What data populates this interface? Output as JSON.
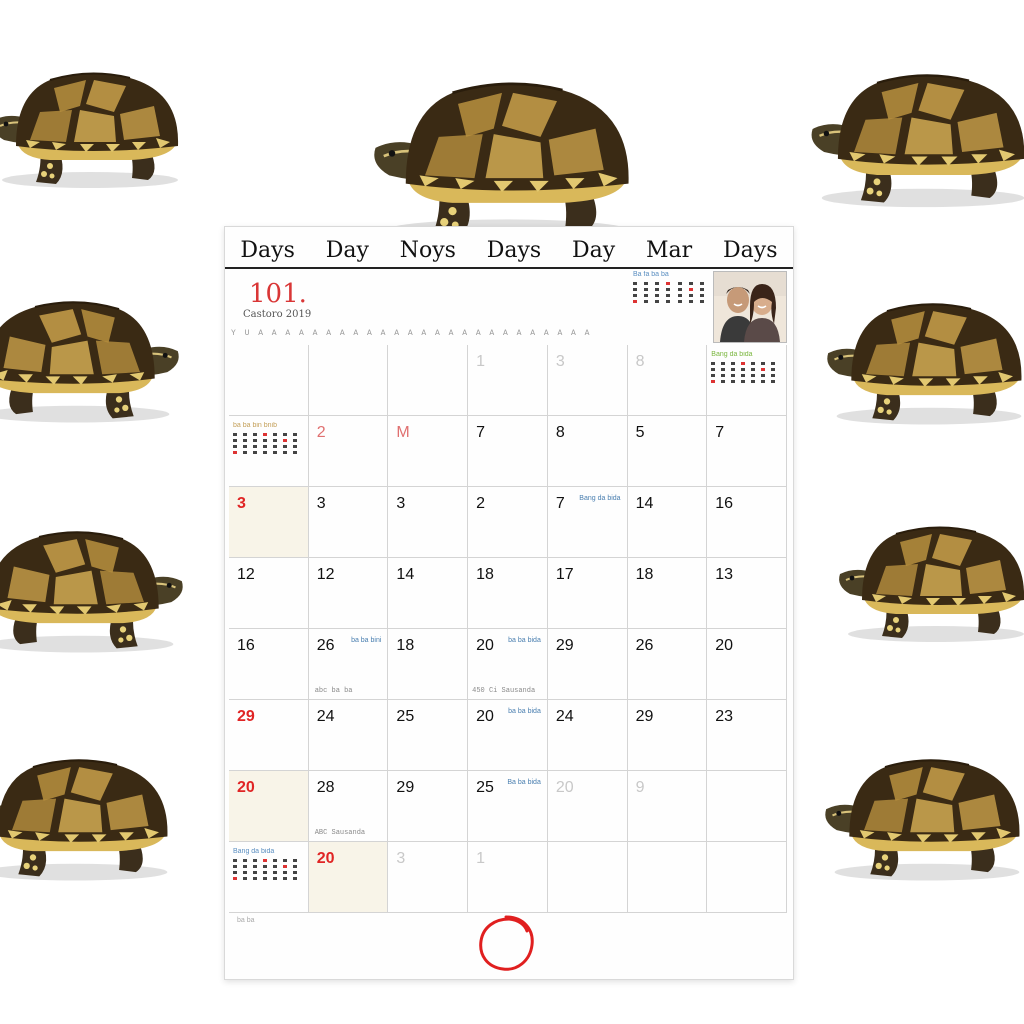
{
  "weekday_headers": [
    "Days",
    "Day",
    "Noys",
    "Days",
    "Day",
    "Mar",
    "Days"
  ],
  "header": {
    "year": "101.",
    "subtitle": "Castoro 2019",
    "tick_row": "Y U A A A A A A A A A A A A A A A A A A A A A A A A A",
    "mini_title": "Ba fa ba ba",
    "photo": "couple photo"
  },
  "rows": [
    [
      {
        "n": ""
      },
      {
        "n": ""
      },
      {
        "n": ""
      },
      {
        "n": "1",
        "s": "faint"
      },
      {
        "n": "3",
        "s": "faint"
      },
      {
        "n": "8",
        "s": "faint"
      },
      {
        "n": "",
        "mini": "green",
        "mini_title": "Bang da bida"
      }
    ],
    [
      {
        "n": "",
        "mini": "tan",
        "mini_title": "ba ba bin bnib"
      },
      {
        "n": "2",
        "s": "pink"
      },
      {
        "n": "M",
        "s": "pink"
      },
      {
        "n": "7"
      },
      {
        "n": "8"
      },
      {
        "n": "5"
      },
      {
        "n": "7"
      }
    ],
    [
      {
        "n": "3",
        "s": "red",
        "cream": true
      },
      {
        "n": "3"
      },
      {
        "n": "3"
      },
      {
        "n": "2"
      },
      {
        "n": "7",
        "note": "Bang da bida"
      },
      {
        "n": "14"
      },
      {
        "n": "16"
      }
    ],
    [
      {
        "n": "12"
      },
      {
        "n": "12"
      },
      {
        "n": "14"
      },
      {
        "n": "18"
      },
      {
        "n": "17"
      },
      {
        "n": "18"
      },
      {
        "n": "13"
      }
    ],
    [
      {
        "n": "16"
      },
      {
        "n": "26",
        "note": "ba ba bini"
      },
      {
        "n": "18"
      },
      {
        "n": "20",
        "note": "ba ba bida"
      },
      {
        "n": "29"
      },
      {
        "n": "26"
      },
      {
        "n": "20"
      }
    ],
    [
      {
        "n": "29",
        "s": "red"
      },
      {
        "n": "24"
      },
      {
        "n": "25"
      },
      {
        "n": "20",
        "note": "ba ba bida"
      },
      {
        "n": "24"
      },
      {
        "n": "29"
      },
      {
        "n": "23"
      }
    ],
    [
      {
        "n": "20",
        "s": "red",
        "cream": true
      },
      {
        "n": "28"
      },
      {
        "n": "29"
      },
      {
        "n": "25",
        "note": "Ba ba bida"
      },
      {
        "n": "20",
        "s": "faint"
      },
      {
        "n": "9",
        "s": "faint"
      },
      {
        "n": ""
      }
    ],
    [
      {
        "n": "",
        "mini": "blue",
        "mini_title": "Bang da bida"
      },
      {
        "n": "20",
        "s": "red",
        "cream": true
      },
      {
        "n": "3",
        "s": "faint"
      },
      {
        "n": "1",
        "s": "faint"
      },
      {
        "n": ""
      },
      {
        "n": ""
      },
      {
        "n": ""
      }
    ]
  ],
  "notes": {
    "r4c2": "abc ba ba",
    "r4c4": "450 Ci Sausanda",
    "r6c2": "ABC Sausanda"
  },
  "footer_text": "ba ba"
}
